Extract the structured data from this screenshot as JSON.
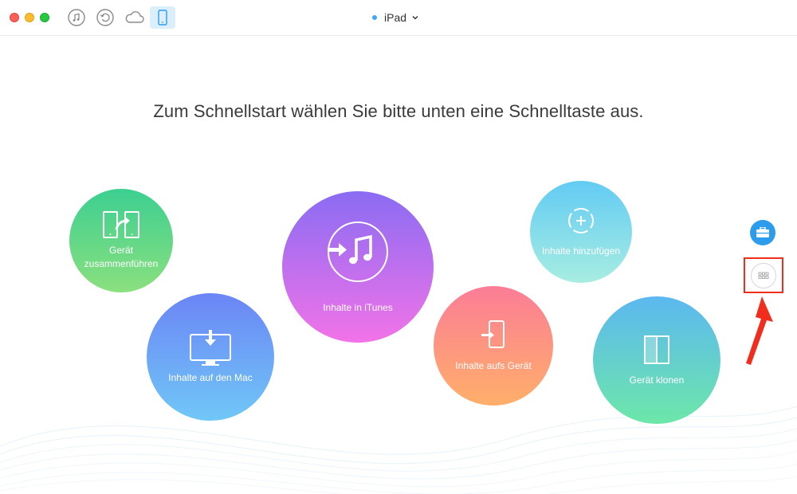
{
  "toolbar": {
    "icons": [
      "music-icon",
      "history-icon",
      "cloud-icon",
      "device-icon"
    ],
    "device_name": "iPad",
    "device_status_color": "#3da8f5"
  },
  "main": {
    "headline": "Zum Schnellstart wählen Sie bitte unten eine Schnelltaste aus.",
    "shortcuts": [
      {
        "label_line1": "Gerät",
        "label_line2": "zusammenführen",
        "icon": "merge-devices-icon"
      },
      {
        "label": "Inhalte auf den Mac",
        "icon": "monitor-download-icon"
      },
      {
        "label": "Inhalte in iTunes",
        "icon": "itunes-import-icon"
      },
      {
        "label": "Inhalte aufs Gerät",
        "icon": "phone-import-icon"
      },
      {
        "label": "Inhalte hinzufügen",
        "icon": "add-content-icon"
      },
      {
        "label": "Gerät klonen",
        "icon": "clone-device-icon"
      }
    ]
  },
  "sidebar": {
    "tools_icon": "toolbox-icon",
    "grid_icon": "grid-icon"
  },
  "annotation": {
    "highlight_color": "#f12e1d"
  }
}
